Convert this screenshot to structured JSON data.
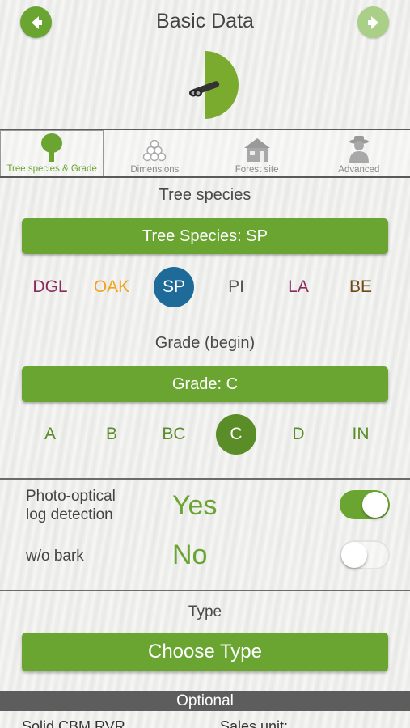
{
  "header": {
    "title": "Basic Data"
  },
  "tabs": [
    {
      "label": "Tree species & Grade",
      "icon": "tree-icon",
      "active": true
    },
    {
      "label": "Dimensions",
      "icon": "log-stack-icon",
      "active": false
    },
    {
      "label": "Forest site",
      "icon": "cabin-icon",
      "active": false
    },
    {
      "label": "Advanced",
      "icon": "forester-icon",
      "active": false
    }
  ],
  "species": {
    "heading": "Tree species",
    "button_label": "Tree Species: SP",
    "options": [
      {
        "label": "DGL",
        "color": "#8b2a5c",
        "selected": false
      },
      {
        "label": "OAK",
        "color": "#f0a21a",
        "selected": false
      },
      {
        "label": "SP",
        "color": "#1e6b99",
        "selected": true
      },
      {
        "label": "PI",
        "color": "#555555",
        "selected": false
      },
      {
        "label": "LA",
        "color": "#8b2a5c",
        "selected": false
      },
      {
        "label": "BE",
        "color": "#6b4a17",
        "selected": false
      }
    ]
  },
  "grade": {
    "heading": "Grade (begin)",
    "button_label": "Grade: C",
    "options": [
      {
        "label": "A",
        "selected": false
      },
      {
        "label": "B",
        "selected": false
      },
      {
        "label": "BC",
        "selected": false
      },
      {
        "label": "C",
        "selected": true
      },
      {
        "label": "D",
        "selected": false
      },
      {
        "label": "IN",
        "selected": false
      }
    ]
  },
  "photo_optical": {
    "label_line1": "Photo-optical",
    "label_line2": "log detection",
    "value": "Yes",
    "on": true
  },
  "bark": {
    "label": "w/o bark",
    "value": "No",
    "on": false
  },
  "type": {
    "heading": "Type",
    "button_label": "Choose Type"
  },
  "optional": {
    "bar_label": "Optional",
    "left_label": "Solid CBM RVR",
    "right_label": "Sales unit:"
  },
  "colors": {
    "accent": "#6aa531",
    "accent_disabled": "#aacf86",
    "species_selected": "#1e6b99",
    "grade_selected": "#5a8c27"
  }
}
